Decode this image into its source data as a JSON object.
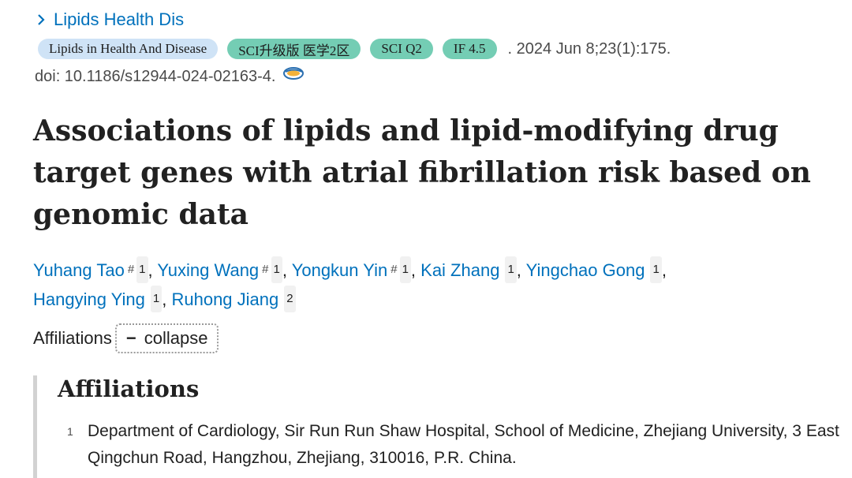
{
  "journal_link": {
    "label": "Lipids Health Dis",
    "icon": "chevron-right-icon"
  },
  "badges": {
    "journal": "Lipids in Health And Disease",
    "sci_tier": "SCI升级版 医学2区",
    "sci_q": "SCI Q2",
    "impact": "IF 4.5"
  },
  "citation": ". 2024 Jun 8;23(1):175.",
  "doi": "doi: 10.1186/s12944-024-02163-4.",
  "title": "Associations of lipids and lipid-modifying drug target genes with atrial fibrillation risk based on genomic data",
  "authors": [
    {
      "name": "Yuhang Tao",
      "mark": "#",
      "aff": "1",
      "sep": ", "
    },
    {
      "name": "Yuxing Wang",
      "mark": "#",
      "aff": "1",
      "sep": ", "
    },
    {
      "name": "Yongkun Yin",
      "mark": "#",
      "aff": "1",
      "sep": ", "
    },
    {
      "name": "Kai Zhang",
      "mark": "",
      "aff": "1",
      "sep": ", "
    },
    {
      "name": "Yingchao Gong",
      "mark": "",
      "aff": "1",
      "sep": ", "
    },
    {
      "name": "Hangying Ying",
      "mark": "",
      "aff": "1",
      "sep": ", "
    },
    {
      "name": "Ruhong Jiang",
      "mark": "",
      "aff": "2",
      "sep": ""
    }
  ],
  "affiliations_toggle": {
    "label": "Affiliations",
    "button": "collapse",
    "icon": "minus-icon"
  },
  "affiliations": {
    "heading": "Affiliations",
    "items": [
      {
        "num": "1",
        "text": "Department of Cardiology, Sir Run Run Shaw Hospital, School of Medicine, Zhejiang University, 3 East Qingchun Road, Hangzhou, Zhejiang, 310016, P.R. China."
      }
    ]
  },
  "colors": {
    "link": "#0071bc",
    "badge_blue": "#cfe3f6",
    "badge_green": "#74cdb4"
  }
}
